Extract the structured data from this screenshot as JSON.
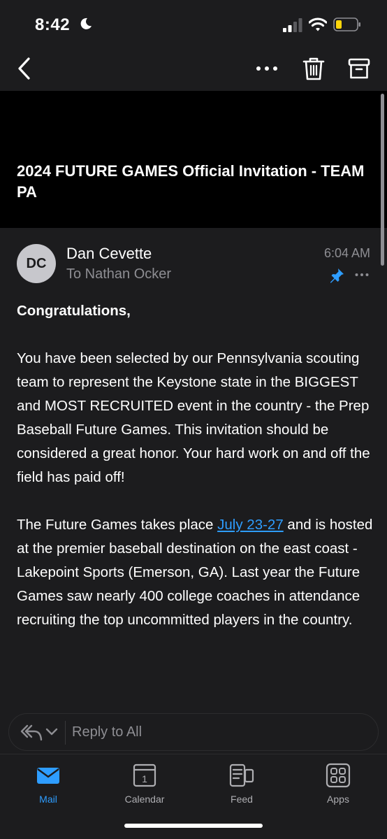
{
  "status_bar": {
    "time": "8:42",
    "battery_color": "#ffd60a"
  },
  "toolbar": {
    "icons": [
      "back-icon",
      "more-icon",
      "trash-icon",
      "archive-icon"
    ]
  },
  "email": {
    "subject": "2024 FUTURE GAMES Official Invitation - TEAM PA",
    "sender_initials": "DC",
    "sender_name": "Dan Cevette",
    "recipient": "To Nathan Ocker",
    "time": "6:04 AM",
    "greeting": "Congratulations,",
    "paragraph_1": "You have been selected by our Pennsylvania scouting team to represent the Keystone state in the BIGGEST and MOST RECRUITED event in the country - the Prep Baseball Future Games. This invitation should be considered a great honor. Your hard work on and off the field has paid off!",
    "paragraph_2_before": "The Future Games takes place ",
    "paragraph_2_link": "July 23-27",
    "paragraph_2_after": " and is hosted at the premier baseball destination on the east coast - Lakepoint Sports (Emerson, GA). Last year the Future Games saw nearly 400 college coaches in attendance recruiting the top uncommitted players in the country."
  },
  "reply_bar": {
    "label": "Reply to All"
  },
  "tab_bar": {
    "tabs": [
      {
        "label": "Mail",
        "icon": "mail-icon",
        "active": true
      },
      {
        "label": "Calendar",
        "icon": "calendar-icon",
        "calendar_day": "1",
        "active": false
      },
      {
        "label": "Feed",
        "icon": "feed-icon",
        "active": false
      },
      {
        "label": "Apps",
        "icon": "apps-icon",
        "active": false
      }
    ]
  },
  "colors": {
    "accent": "#2e9dff",
    "background": "#1c1c1e",
    "header_background": "#000000",
    "secondary_text": "#8e8e93"
  }
}
